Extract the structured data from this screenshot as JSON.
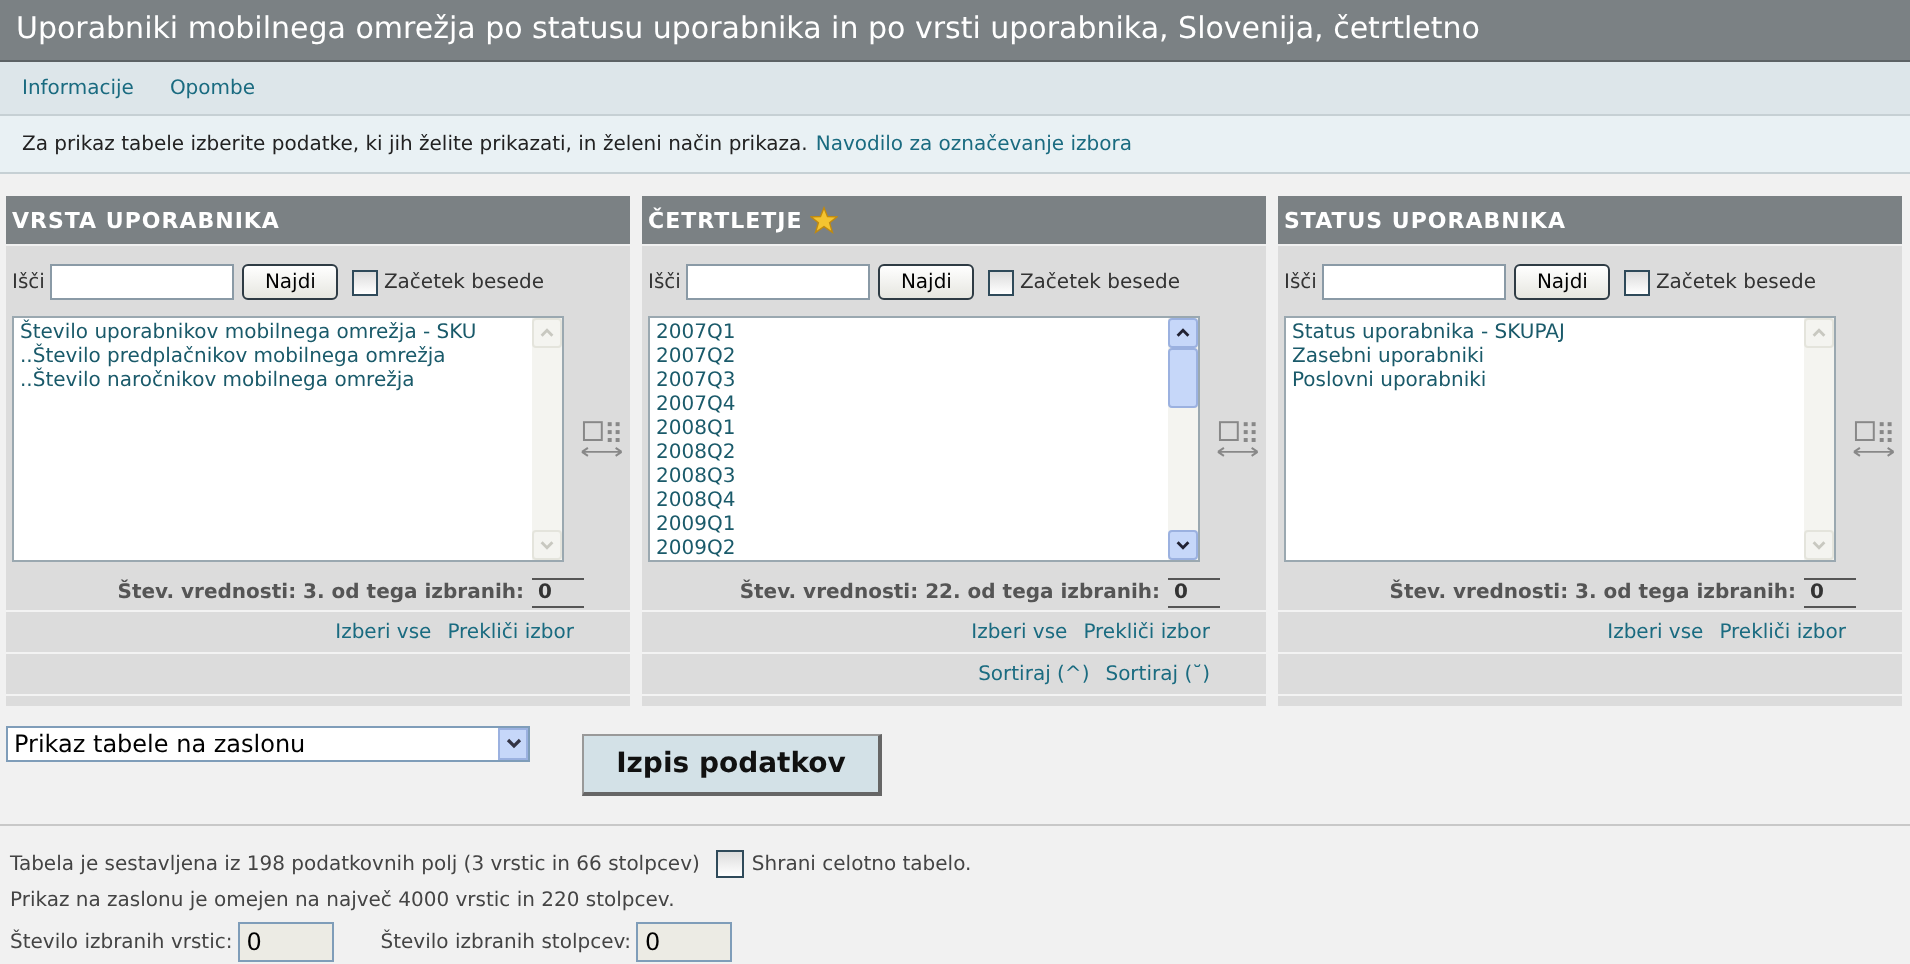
{
  "title": "Uporabniki mobilnega omrežja po statusu uporabnika in po vrsti uporabnika, Slovenija, četrtletno",
  "nav": [
    "Informacije",
    "Opombe"
  ],
  "info": {
    "text": "Za prikaz tabele izberite podatke, ki jih želite prikazati, in želeni način prikaza.",
    "link": "Navodilo za označevanje izbora"
  },
  "panels": [
    {
      "title": "VRSTA UPORABNIKA",
      "starred": false,
      "search_label": "Išči",
      "search_button": "Najdi",
      "word_start": {
        "label": "Začetek besede",
        "checked": false
      },
      "items": [
        {
          "label": "Število uporabnikov mobilnega omrežja - SKU",
          "selected": false
        },
        {
          "label": "..Število predplačnikov mobilnega omrežja",
          "selected": false
        },
        {
          "label": "..Število naročnikov mobilnega omrežja",
          "selected": false
        }
      ],
      "count_text": "Štev. vrednosti: 3. od tega izbranih:",
      "selected_count": "0",
      "actions": [
        "Izberi vse",
        "Prekliči izbor"
      ]
    },
    {
      "title": "ČETRTLETJE",
      "starred": true,
      "search_label": "Išči",
      "search_button": "Najdi",
      "word_start": {
        "label": "Začetek besede",
        "checked": false
      },
      "items": [
        {
          "label": "2007Q1",
          "selected": false
        },
        {
          "label": "2007Q2",
          "selected": false
        },
        {
          "label": "2007Q3",
          "selected": false
        },
        {
          "label": "2007Q4",
          "selected": false
        },
        {
          "label": "2008Q1",
          "selected": false
        },
        {
          "label": "2008Q2",
          "selected": false
        },
        {
          "label": "2008Q3",
          "selected": false
        },
        {
          "label": "2008Q4",
          "selected": false
        },
        {
          "label": "2009Q1",
          "selected": false
        },
        {
          "label": "2009Q2",
          "selected": false
        }
      ],
      "count_text": "Štev. vrednosti: 22. od tega izbranih:",
      "selected_count": "0",
      "actions": [
        "Izberi vse",
        "Prekliči izbor"
      ],
      "sort": [
        "Sortiraj (^)",
        "Sortiraj (˘)"
      ]
    },
    {
      "title": "STATUS UPORABNIKA",
      "starred": false,
      "search_label": "Išči",
      "search_button": "Najdi",
      "word_start": {
        "label": "Začetek besede",
        "checked": false
      },
      "items": [
        {
          "label": "Status uporabnika - SKUPAJ",
          "selected": false
        },
        {
          "label": "Zasebni uporabniki",
          "selected": false
        },
        {
          "label": "Poslovni uporabniki",
          "selected": false
        }
      ],
      "count_text": "Štev. vrednosti: 3. od tega izbranih:",
      "selected_count": "0",
      "actions": [
        "Izberi vse",
        "Prekliči izbor"
      ]
    }
  ],
  "output_select": "Prikaz tabele na zaslonu",
  "submit": "Izpis podatkov",
  "summary": {
    "text": "Tabela je sestavljena iz 198 podatkovnih polj (3 vrstic in 66 stolpcev)",
    "save_all": {
      "label": "Shrani celotno tabelo.",
      "checked": false
    },
    "limit": "Prikaz na zaslonu je omejen na največ 4000 vrstic in 220 stolpcev."
  },
  "counts": [
    {
      "label": "Število izbranih vrstic:",
      "value": "0"
    },
    {
      "label": "Število izbranih stolpcev:",
      "value": "0"
    }
  ]
}
